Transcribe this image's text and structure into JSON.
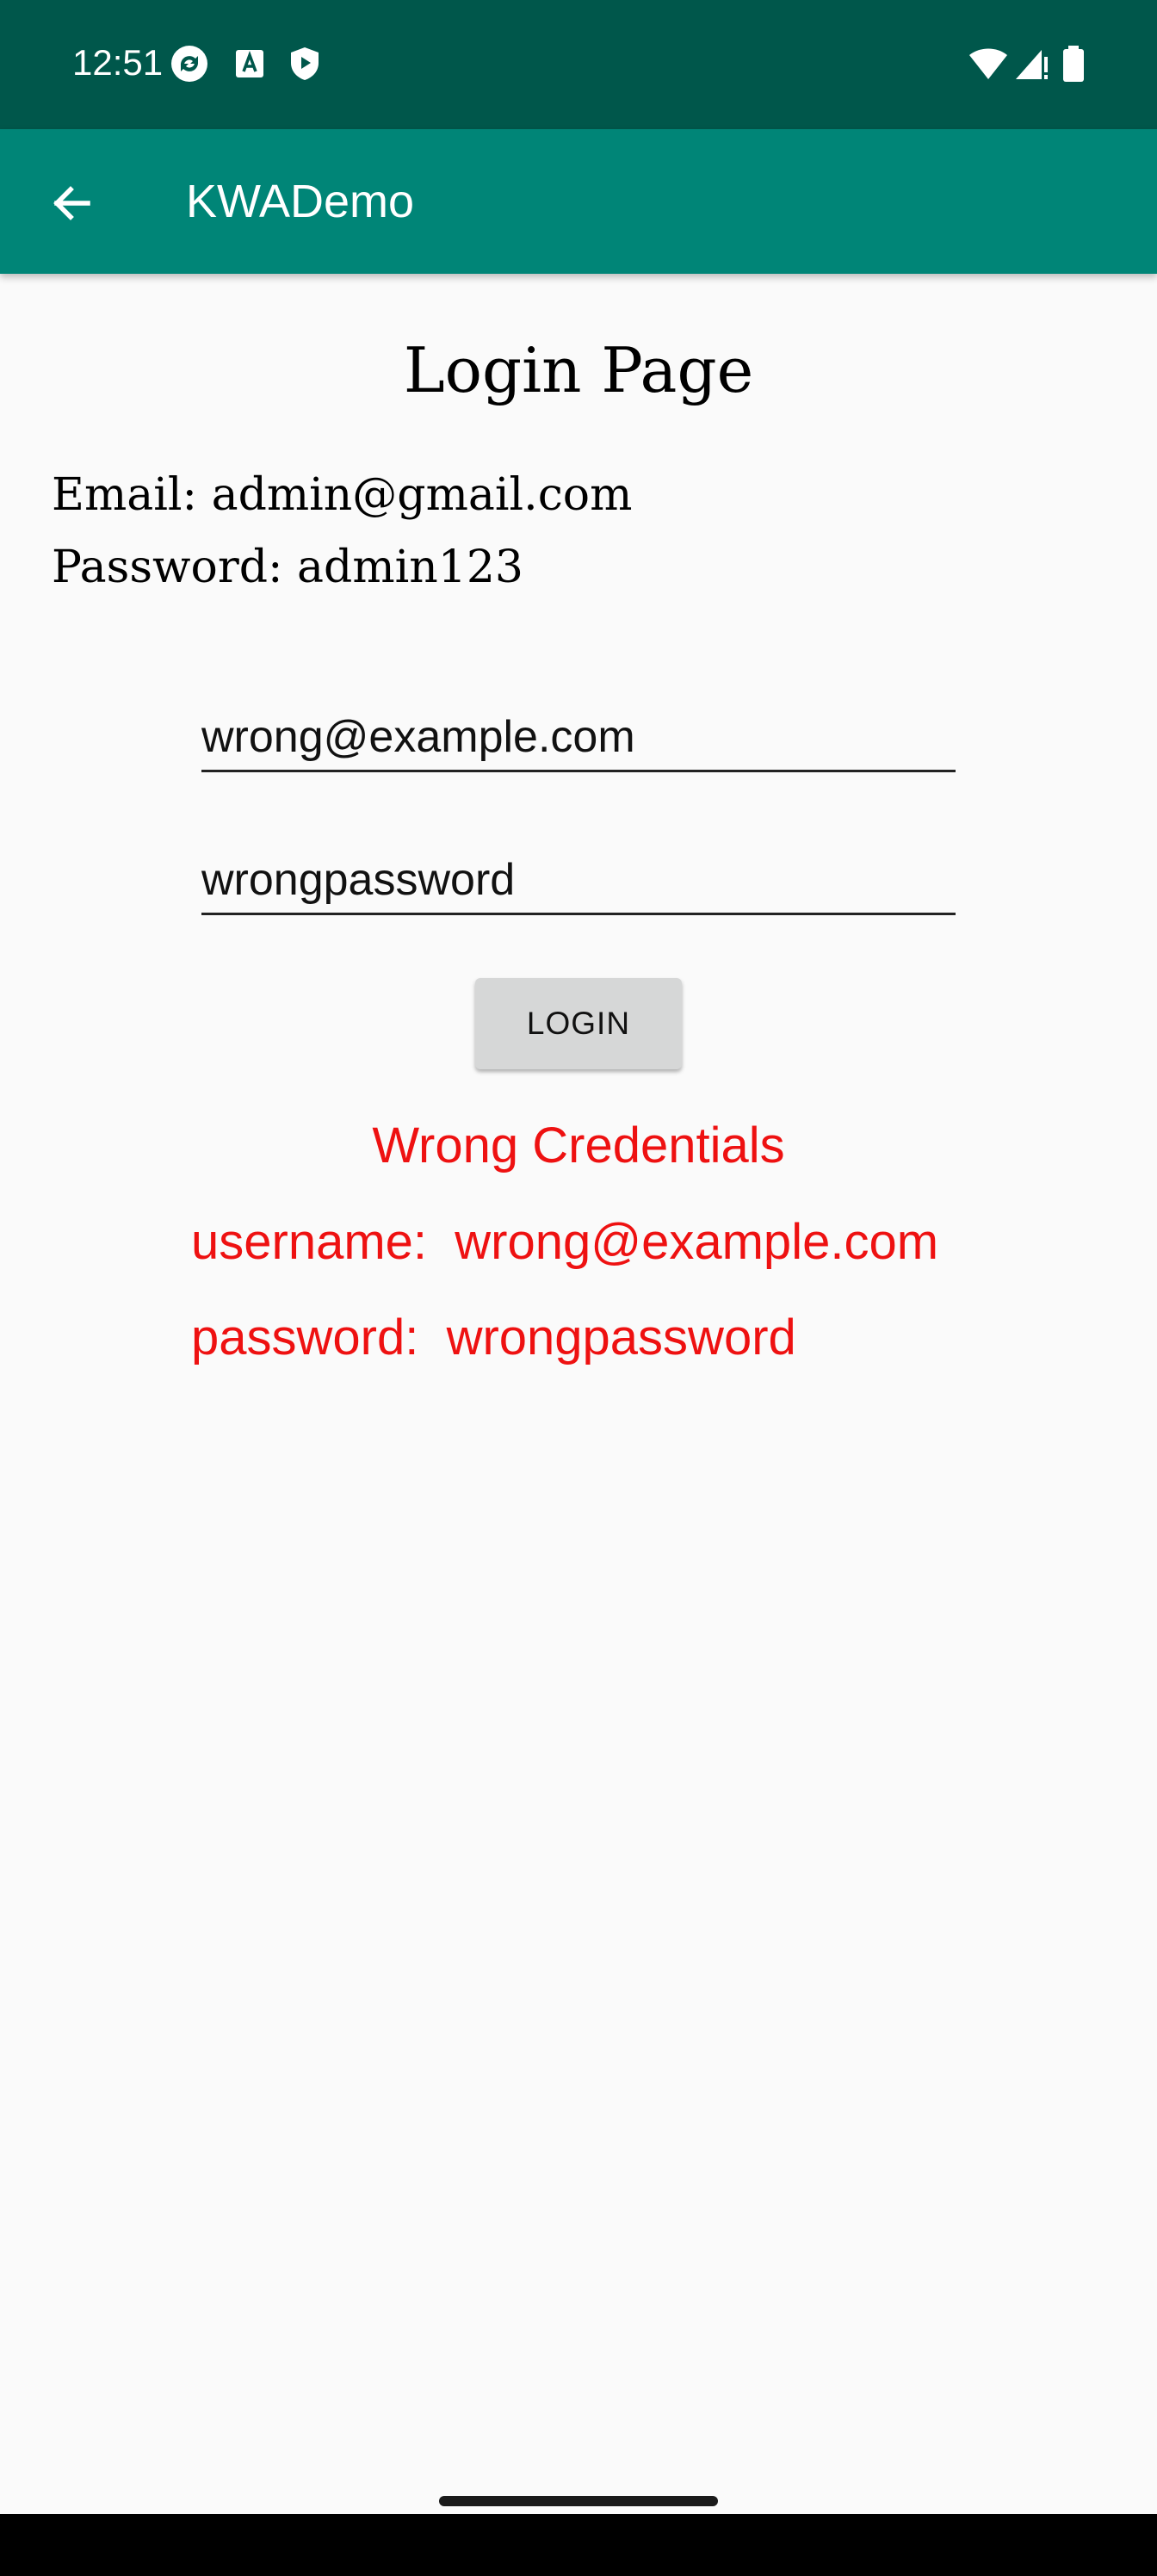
{
  "status_bar": {
    "time": "12:51",
    "left_icons": [
      "sync-icon",
      "keyboard-a-icon",
      "shield-play-icon"
    ],
    "right_icons": [
      "wifi-icon",
      "signal-icon",
      "battery-icon"
    ],
    "background": "#00574b"
  },
  "app_bar": {
    "title": "KWADemo",
    "background": "#008577",
    "back_icon": "arrow-back-icon"
  },
  "main": {
    "page_title": "Login Page",
    "hint_email": "Email: admin@gmail.com",
    "hint_password": "Password: admin123",
    "email_input": {
      "value": "wrong@example.com"
    },
    "password_input": {
      "value": "wrongpassword"
    },
    "login_button": "LOGIN",
    "error": {
      "title": "Wrong Credentials",
      "username_line": "username:  wrong@example.com",
      "password_line": "password:  wrongpassword",
      "color": "#ee1111"
    }
  }
}
